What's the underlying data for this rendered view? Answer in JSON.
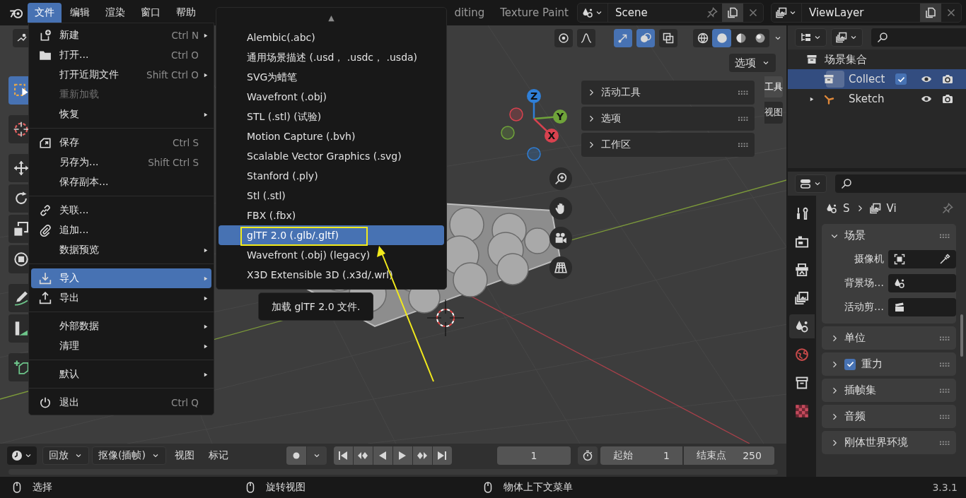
{
  "top_bar": {
    "menus": [
      {
        "label": "文件",
        "selected": true
      },
      {
        "label": "编辑",
        "selected": false
      },
      {
        "label": "渲染",
        "selected": false
      },
      {
        "label": "窗口",
        "selected": false
      },
      {
        "label": "帮助",
        "selected": false
      }
    ],
    "workspace_tabs": [
      {
        "label": "diting",
        "selected": false
      },
      {
        "label": "Texture Paint",
        "selected": false
      }
    ],
    "scene": "Scene",
    "view_layer": "ViewLayer"
  },
  "file_menu": {
    "sections": [
      {
        "items": [
          {
            "label": "新建",
            "shortcut": "Ctrl N",
            "submenu": true,
            "disabled": false,
            "selected": false
          },
          {
            "label": "打开...",
            "shortcut": "Ctrl O",
            "submenu": false,
            "disabled": false,
            "selected": false
          },
          {
            "label": "打开近期文件",
            "shortcut": "Shift Ctrl O",
            "submenu": true,
            "disabled": false,
            "selected": false
          },
          {
            "label": "重新加载",
            "submenu": false,
            "disabled": true,
            "selected": false
          },
          {
            "label": "恢复",
            "submenu": true,
            "disabled": false,
            "selected": false
          }
        ]
      },
      {
        "items": [
          {
            "label": "保存",
            "shortcut": "Ctrl S",
            "submenu": false,
            "disabled": false,
            "selected": false
          },
          {
            "label": "另存为...",
            "shortcut": "Shift Ctrl S",
            "submenu": false,
            "disabled": false,
            "selected": false
          },
          {
            "label": "保存副本...",
            "submenu": false,
            "disabled": false,
            "selected": false
          }
        ]
      },
      {
        "items": [
          {
            "label": "关联...",
            "submenu": false,
            "disabled": false,
            "selected": false
          },
          {
            "label": "追加...",
            "submenu": false,
            "disabled": false,
            "selected": false
          },
          {
            "label": "数据预览",
            "submenu": true,
            "disabled": false,
            "selected": false
          }
        ]
      },
      {
        "items": [
          {
            "label": "导入",
            "submenu": true,
            "disabled": false,
            "selected": true
          },
          {
            "label": "导出",
            "submenu": true,
            "disabled": false,
            "selected": false
          }
        ]
      },
      {
        "items": [
          {
            "label": "外部数据",
            "submenu": true,
            "disabled": false,
            "selected": false
          },
          {
            "label": "清理",
            "submenu": true,
            "disabled": false,
            "selected": false
          }
        ]
      },
      {
        "items": [
          {
            "label": "默认",
            "submenu": true,
            "disabled": false,
            "selected": false
          }
        ]
      },
      {
        "items": [
          {
            "label": "退出",
            "shortcut": "Ctrl Q",
            "submenu": false,
            "disabled": false,
            "selected": false
          }
        ]
      }
    ]
  },
  "import_submenu": {
    "scroll_indicator": "▲",
    "items": [
      {
        "label": "Alembic(.abc)",
        "selected": false
      },
      {
        "label": "通用场景描述 (.usd， .usdc， .usda)",
        "selected": false
      },
      {
        "label": "SVG为蜡笔",
        "selected": false
      },
      {
        "label": "Wavefront (.obj)",
        "selected": false
      },
      {
        "label": "STL (.stl) (试验)",
        "selected": false
      },
      {
        "label": "Motion Capture (.bvh)",
        "selected": false
      },
      {
        "label": "Scalable Vector Graphics (.svg)",
        "selected": false
      },
      {
        "label": "Stanford (.ply)",
        "selected": false
      },
      {
        "label": "Stl (.stl)",
        "selected": false
      },
      {
        "label": "FBX (.fbx)",
        "selected": false
      },
      {
        "label": "glTF 2.0 (.glb/.gltf)",
        "selected": true
      },
      {
        "label": "Wavefront (.obj) (legacy)",
        "selected": false
      },
      {
        "label": "X3D Extensible 3D (.x3d/.wrl)",
        "selected": false
      }
    ],
    "tooltip": "加载 glTF 2.0 文件."
  },
  "viewport": {
    "header_toggles": [
      {
        "on": false
      },
      {
        "on": false
      },
      {
        "on": true
      },
      {
        "on": true
      },
      {
        "on": false
      }
    ],
    "shading_modes": [
      {
        "selected": false
      },
      {
        "selected": true
      },
      {
        "selected": false
      },
      {
        "selected": false
      }
    ],
    "options_dropdown": "选项",
    "tools": [
      {
        "selected": true
      },
      {
        "selected": false
      },
      {
        "selected": false
      },
      {
        "selected": false
      },
      {
        "selected": false
      },
      {
        "selected": false
      },
      {
        "selected": false
      },
      {
        "selected": false
      },
      {
        "selected": false
      }
    ],
    "gizmo_axes": [
      "Z",
      "Y",
      "X"
    ],
    "sidebar_panels": [
      {
        "title": "活动工具",
        "expanded": false
      },
      {
        "title": "选项",
        "expanded": false
      },
      {
        "title": "工作区",
        "expanded": false
      }
    ],
    "sidebar_tabs": [
      {
        "label": "工具",
        "selected": true
      },
      {
        "label": "视图",
        "selected": false
      }
    ]
  },
  "outliner": {
    "items": [
      {
        "label": "场景集合",
        "selected": false,
        "children": [
          {
            "label": "Collect",
            "selected": true,
            "checked": true
          },
          {
            "label": "Sketch",
            "selected": false,
            "expanded": false
          }
        ]
      }
    ]
  },
  "properties": {
    "tabs": [
      {
        "selected": false
      },
      {
        "selected": false
      },
      {
        "selected": false
      },
      {
        "selected": false
      },
      {
        "selected": true
      },
      {
        "selected": false
      },
      {
        "selected": false
      },
      {
        "selected": false
      }
    ],
    "breadcrumb": [
      "S",
      "Vi"
    ],
    "panels": [
      {
        "title": "场景",
        "expanded": true,
        "fields": [
          "摄像机",
          "背景场…",
          "活动剪…"
        ]
      },
      {
        "title": "单位",
        "expanded": false
      },
      {
        "title": "重力",
        "expanded": false,
        "checked": true
      },
      {
        "title": "插帧集",
        "expanded": false
      },
      {
        "title": "音频",
        "expanded": false
      },
      {
        "title": "刚体世界环境",
        "expanded": false
      }
    ]
  },
  "timeline": {
    "menus": [
      {
        "label": "回放",
        "dropdown": true
      },
      {
        "label": "抠像(插帧)",
        "dropdown": true
      },
      {
        "label": "视图",
        "dropdown": false
      },
      {
        "label": "标记",
        "dropdown": false
      }
    ],
    "current_frame": "1",
    "start_label": "起始",
    "start": "1",
    "end_label": "结束点",
    "end": "250"
  },
  "status_bar": {
    "hints": [
      "选择",
      "旋转视图",
      "物体上下文菜单"
    ],
    "version": "3.3.1"
  }
}
